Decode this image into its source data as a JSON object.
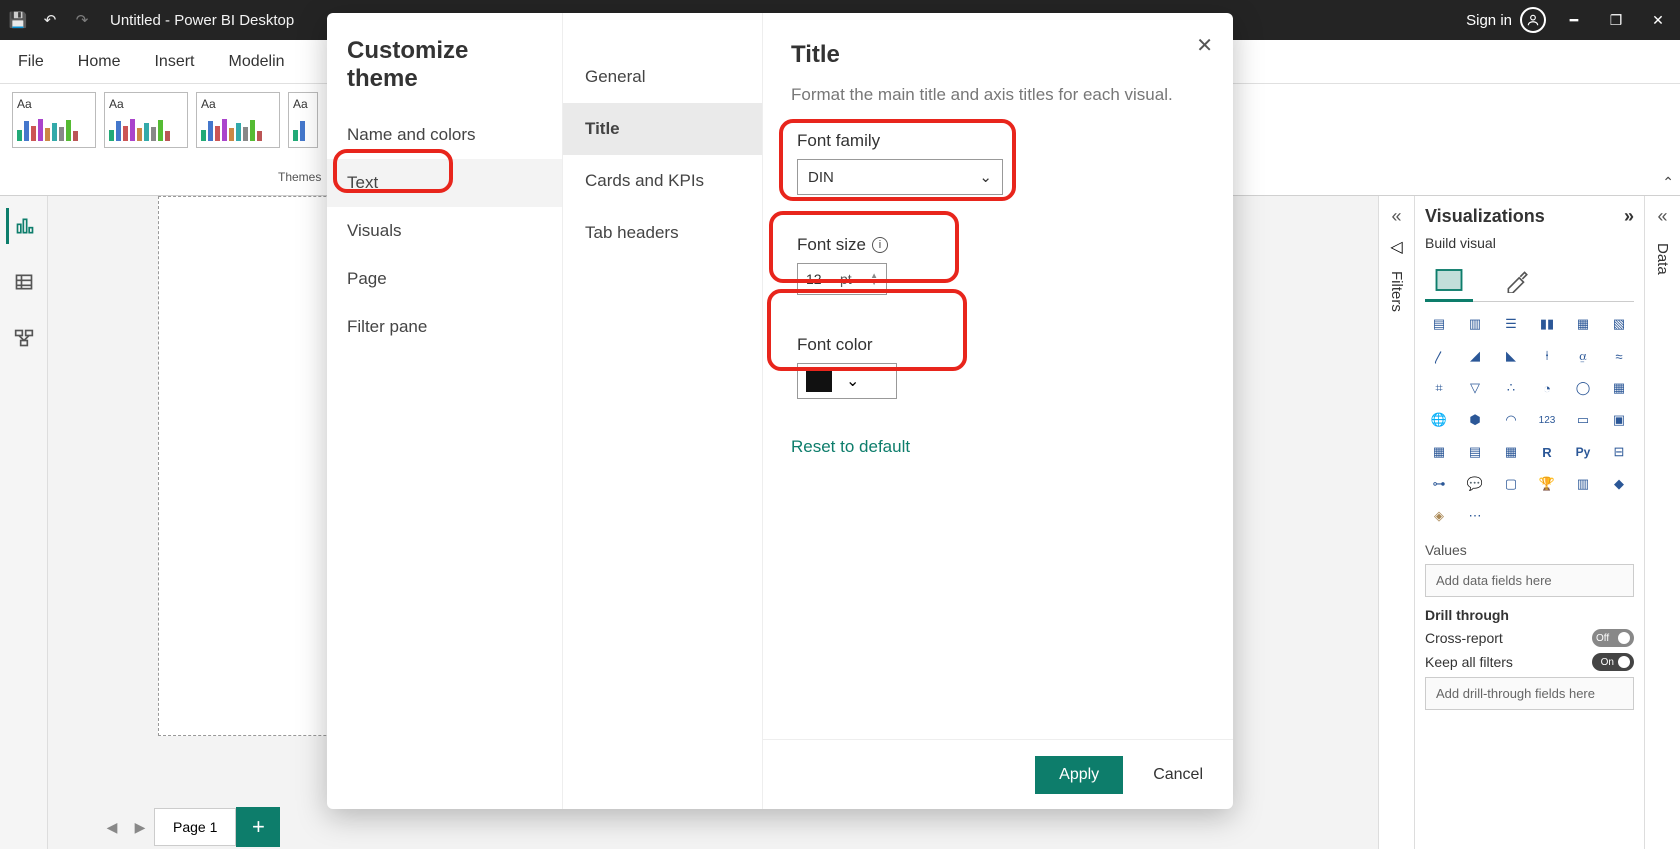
{
  "titlebar": {
    "title": "Untitled - Power BI Desktop",
    "signin": "Sign in"
  },
  "ribbon": {
    "tabs": [
      "File",
      "Home",
      "Insert",
      "Modelin"
    ],
    "themes_label": "Themes"
  },
  "pages": {
    "page1": "Page 1"
  },
  "filters_panel": {
    "label": "Filters"
  },
  "data_panel": {
    "label": "Data"
  },
  "viz_panel": {
    "title": "Visualizations",
    "subtitle": "Build visual",
    "values_label": "Values",
    "values_placeholder": "Add data fields here",
    "drill_label": "Drill through",
    "cross_report": "Cross-report",
    "cross_report_state": "Off",
    "keep_filters": "Keep all filters",
    "keep_filters_state": "On",
    "drill_placeholder": "Add drill-through fields here"
  },
  "modal": {
    "title": "Customize theme",
    "left_items": [
      "Name and colors",
      "Text",
      "Visuals",
      "Page",
      "Filter pane"
    ],
    "left_selected": "Text",
    "mid_items": [
      "General",
      "Title",
      "Cards and KPIs",
      "Tab headers"
    ],
    "mid_selected": "Title",
    "right": {
      "heading": "Title",
      "desc": "Format the main title and axis titles for each visual.",
      "font_family_label": "Font family",
      "font_family_value": "DIN",
      "font_size_label": "Font size",
      "font_size_value": "12",
      "font_size_unit": "pt",
      "font_color_label": "Font color",
      "font_color_value": "#111111",
      "reset": "Reset to default"
    },
    "apply": "Apply",
    "cancel": "Cancel"
  }
}
